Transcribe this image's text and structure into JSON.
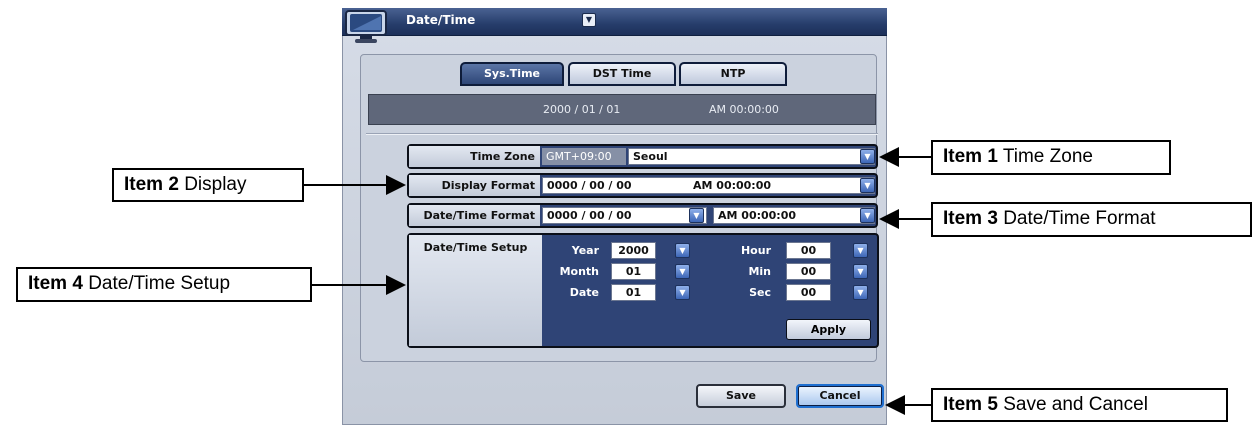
{
  "window": {
    "title": "Date/Time"
  },
  "tabs": [
    {
      "label": "Sys.Time",
      "selected": true
    },
    {
      "label": "DST Time",
      "selected": false
    },
    {
      "label": "NTP",
      "selected": false
    }
  ],
  "status_display": {
    "date": "2000 / 01 / 01",
    "time": "AM 00:00:00"
  },
  "time_zone": {
    "label": "Time Zone",
    "offset": "GMT+09:00",
    "city": "Seoul"
  },
  "display_format": {
    "label": "Display Format",
    "date": "0000 / 00 / 00",
    "time": "AM 00:00:00"
  },
  "datetime_format": {
    "label": "Date/Time Format",
    "date": "0000 / 00 / 00",
    "time": "AM 00:00:00"
  },
  "setup": {
    "label": "Date/Time Setup",
    "year": {
      "label": "Year",
      "value": "2000"
    },
    "month": {
      "label": "Month",
      "value": "01"
    },
    "date": {
      "label": "Date",
      "value": "01"
    },
    "hour": {
      "label": "Hour",
      "value": "00"
    },
    "min": {
      "label": "Min",
      "value": "00"
    },
    "sec": {
      "label": "Sec",
      "value": "00"
    },
    "apply_label": "Apply"
  },
  "buttons": {
    "save": "Save",
    "cancel": "Cancel"
  },
  "dropdown_glyph": "▼",
  "callouts": {
    "item1": {
      "tag": "Item 1",
      "text": "Time Zone"
    },
    "item2": {
      "tag": "Item 2",
      "text": "Display"
    },
    "item3": {
      "tag": "Item 3",
      "text": "Date/Time Format"
    },
    "item4": {
      "tag": "Item 4",
      "text": "Date/Time Setup"
    },
    "item5": {
      "tag": "Item 5",
      "text": "Save and Cancel"
    }
  },
  "colors": {
    "titlebar": "#263d6b",
    "row_fill": "#2f4476",
    "cancel_accent": "#1f6fd0"
  }
}
